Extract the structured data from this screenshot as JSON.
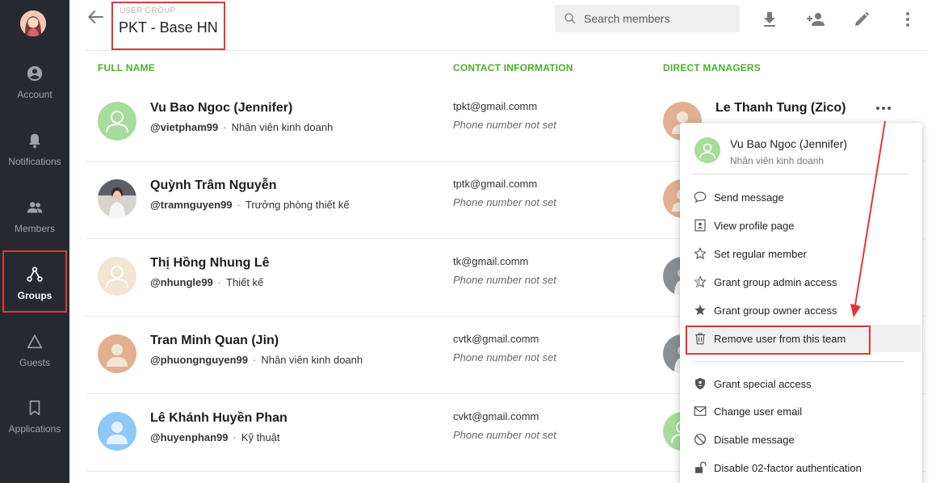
{
  "sidebar": {
    "items": [
      {
        "label": "Account",
        "icon": "account-circle-icon"
      },
      {
        "label": "Notifications",
        "icon": "bell-icon"
      },
      {
        "label": "Members",
        "icon": "people-icon"
      },
      {
        "label": "Groups",
        "icon": "group-tree-icon",
        "active": true
      },
      {
        "label": "Guests",
        "icon": "triangle-icon"
      },
      {
        "label": "Applications",
        "icon": "bookmark-icon"
      }
    ]
  },
  "header": {
    "group_label": "USER GROUP",
    "group_name": "PKT - Base HN",
    "search_placeholder": "Search members"
  },
  "table": {
    "columns": [
      "FULL NAME",
      "CONTACT INFORMATION",
      "DIRECT MANAGERS"
    ],
    "rows": [
      {
        "name": "Vu Bao Ngoc (Jennifer)",
        "handle": "@vietpham99",
        "role": "Nhân viên kinh doanh",
        "email": "tpkt@gmail.comm",
        "phone": "Phone number not set",
        "avatar_color": "#a5dd9b"
      },
      {
        "name": "Quỳnh Trâm Nguyễn",
        "handle": "@tramnguyen99",
        "role": "Trưởng phòng thiết kế",
        "email": "tptk@gmail.comm",
        "phone": "Phone number not set",
        "avatar_color": "#d9d3cd"
      },
      {
        "name": "Thị Hồng Nhung Lê",
        "handle": "@nhungle99",
        "role": "Thiết kế",
        "email": "tk@gmail.comm",
        "phone": "Phone number not set",
        "avatar_color": "#f0e6d2"
      },
      {
        "name": "Tran Minh Quan (Jin)",
        "handle": "@phuongnguyen99",
        "role": "Nhân viên kinh doanh",
        "email": "cvtk@gmail.comm",
        "phone": "Phone number not set",
        "avatar_color": "#e0b090"
      },
      {
        "name": "Lê Khánh Huyền Phan",
        "handle": "@huyenphan99",
        "role": "Kỹ thuật",
        "email": "cvkt@gmail.comm",
        "phone": "Phone number not set",
        "avatar_color": "#8fc8f5"
      }
    ],
    "manager": {
      "name": "Le Thanh Tung (Zico)"
    }
  },
  "menu": {
    "user_name": "Vu Bao Ngoc (Jennifer)",
    "user_role": "Nhân viên kinh doanh",
    "items": [
      {
        "label": "Send message",
        "icon": "chat-bubble-icon"
      },
      {
        "label": "View profile page",
        "icon": "profile-card-icon"
      },
      {
        "label": "Set regular member",
        "icon": "star-outline-icon"
      },
      {
        "label": "Grant group admin access",
        "icon": "star-half-icon"
      },
      {
        "label": "Grant group owner access",
        "icon": "star-filled-icon"
      },
      {
        "label": "Remove user from this team",
        "icon": "trash-icon"
      },
      {
        "label": "Grant special access",
        "icon": "shield-icon"
      },
      {
        "label": "Change user email",
        "icon": "envelope-icon"
      },
      {
        "label": "Disable message",
        "icon": "block-icon"
      },
      {
        "label": "Disable 02-factor authentication",
        "icon": "unlock-icon"
      }
    ]
  },
  "colors": {
    "accent_green": "#4caf2f",
    "highlight_red": "#e23636",
    "sidebar_bg": "#262a30"
  }
}
